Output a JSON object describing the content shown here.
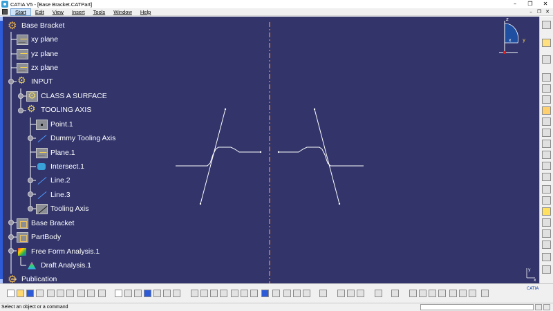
{
  "window": {
    "title": "CATIA V5 - [Base Bracket.CATPart]",
    "controls": {
      "minimize": "–",
      "restore": "❐",
      "close": "✕"
    }
  },
  "menu": {
    "items": [
      "Start",
      "Edit",
      "View",
      "Insert",
      "Tools",
      "Window",
      "Help"
    ],
    "doc_controls": {
      "minimize": "–",
      "restore": "❐",
      "close": "✕"
    }
  },
  "tree": {
    "nodes": [
      {
        "label": "Base Bracket",
        "icon": "gear-icon"
      },
      {
        "label": "xy plane",
        "icon": "plane-icon"
      },
      {
        "label": "yz plane",
        "icon": "plane-icon"
      },
      {
        "label": "zx plane",
        "icon": "plane-icon"
      },
      {
        "label": "INPUT",
        "icon": "geometrical-set-icon"
      },
      {
        "label": "CLASS A SURFACE",
        "icon": "geometrical-set-icon"
      },
      {
        "label": "TOOLING AXIS",
        "icon": "geometrical-set-icon"
      },
      {
        "label": "Point.1",
        "icon": "point-icon"
      },
      {
        "label": "Dummy Tooling Axis",
        "icon": "line-icon"
      },
      {
        "label": "Plane.1",
        "icon": "plane-icon"
      },
      {
        "label": "Intersect.1",
        "icon": "intersect-icon"
      },
      {
        "label": "Line.2",
        "icon": "line-icon"
      },
      {
        "label": "Line.3",
        "icon": "line-icon"
      },
      {
        "label": "Tooling Axis",
        "icon": "axis-icon"
      },
      {
        "label": "Base Bracket",
        "icon": "body-icon"
      },
      {
        "label": "PartBody",
        "icon": "body-icon"
      },
      {
        "label": "Free Form Analysis.1",
        "icon": "analysis-icon"
      },
      {
        "label": "Draft Analysis.1",
        "icon": "draft-analysis-icon"
      },
      {
        "label": "Publication",
        "icon": "gear-icon"
      }
    ]
  },
  "compass": {
    "z": "z",
    "x": "x",
    "y": "y"
  },
  "axis_triad": {
    "y": "y",
    "x": "x"
  },
  "status": {
    "message": "Select an object or a command",
    "command_value": ""
  },
  "logo": "CATIA",
  "colors": {
    "viewport_bg": "#32346a",
    "axis_line": "#e07a1a",
    "profile": "#ffffff",
    "tree_text": "#ffffff"
  }
}
